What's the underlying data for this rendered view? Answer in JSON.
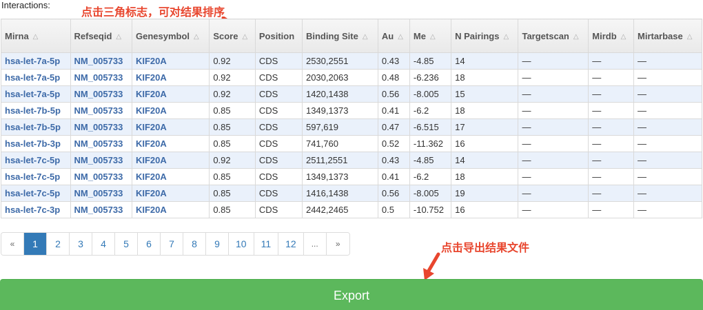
{
  "title": "Interactions:",
  "annotations": {
    "sort_hint": "点击三角标志，可对结果排序",
    "export_hint": "点击导出结果文件"
  },
  "colors": {
    "accent": "#e8462e",
    "link": "#3d6aa8",
    "export": "#5cb85c",
    "active_page": "#337ab7"
  },
  "table": {
    "headers": [
      "Mirna",
      "Refseqid",
      "Genesymbol",
      "Score",
      "Position",
      "Binding Site",
      "Au",
      "Me",
      "N Pairings",
      "Targetscan",
      "Mirdb",
      "Mirtarbase"
    ],
    "rows": [
      [
        "hsa-let-7a-5p",
        "NM_005733",
        "KIF20A",
        "0.92",
        "CDS",
        "2530,2551",
        "0.43",
        "-4.85",
        "14",
        "—",
        "—",
        "—"
      ],
      [
        "hsa-let-7a-5p",
        "NM_005733",
        "KIF20A",
        "0.92",
        "CDS",
        "2030,2063",
        "0.48",
        "-6.236",
        "18",
        "—",
        "—",
        "—"
      ],
      [
        "hsa-let-7a-5p",
        "NM_005733",
        "KIF20A",
        "0.92",
        "CDS",
        "1420,1438",
        "0.56",
        "-8.005",
        "15",
        "—",
        "—",
        "—"
      ],
      [
        "hsa-let-7b-5p",
        "NM_005733",
        "KIF20A",
        "0.85",
        "CDS",
        "1349,1373",
        "0.41",
        "-6.2",
        "18",
        "—",
        "—",
        "—"
      ],
      [
        "hsa-let-7b-5p",
        "NM_005733",
        "KIF20A",
        "0.85",
        "CDS",
        "597,619",
        "0.47",
        "-6.515",
        "17",
        "—",
        "—",
        "—"
      ],
      [
        "hsa-let-7b-3p",
        "NM_005733",
        "KIF20A",
        "0.85",
        "CDS",
        "741,760",
        "0.52",
        "-11.362",
        "16",
        "—",
        "—",
        "—"
      ],
      [
        "hsa-let-7c-5p",
        "NM_005733",
        "KIF20A",
        "0.92",
        "CDS",
        "2511,2551",
        "0.43",
        "-4.85",
        "14",
        "—",
        "—",
        "—"
      ],
      [
        "hsa-let-7c-5p",
        "NM_005733",
        "KIF20A",
        "0.85",
        "CDS",
        "1349,1373",
        "0.41",
        "-6.2",
        "18",
        "—",
        "—",
        "—"
      ],
      [
        "hsa-let-7c-5p",
        "NM_005733",
        "KIF20A",
        "0.85",
        "CDS",
        "1416,1438",
        "0.56",
        "-8.005",
        "19",
        "—",
        "—",
        "—"
      ],
      [
        "hsa-let-7c-3p",
        "NM_005733",
        "KIF20A",
        "0.85",
        "CDS",
        "2442,2465",
        "0.5",
        "-10.752",
        "16",
        "—",
        "—",
        "—"
      ]
    ]
  },
  "pagination": {
    "items": [
      "«",
      "1",
      "2",
      "3",
      "4",
      "5",
      "6",
      "7",
      "8",
      "9",
      "10",
      "11",
      "12",
      "...",
      "»"
    ],
    "active": "1"
  },
  "export_label": "Export"
}
